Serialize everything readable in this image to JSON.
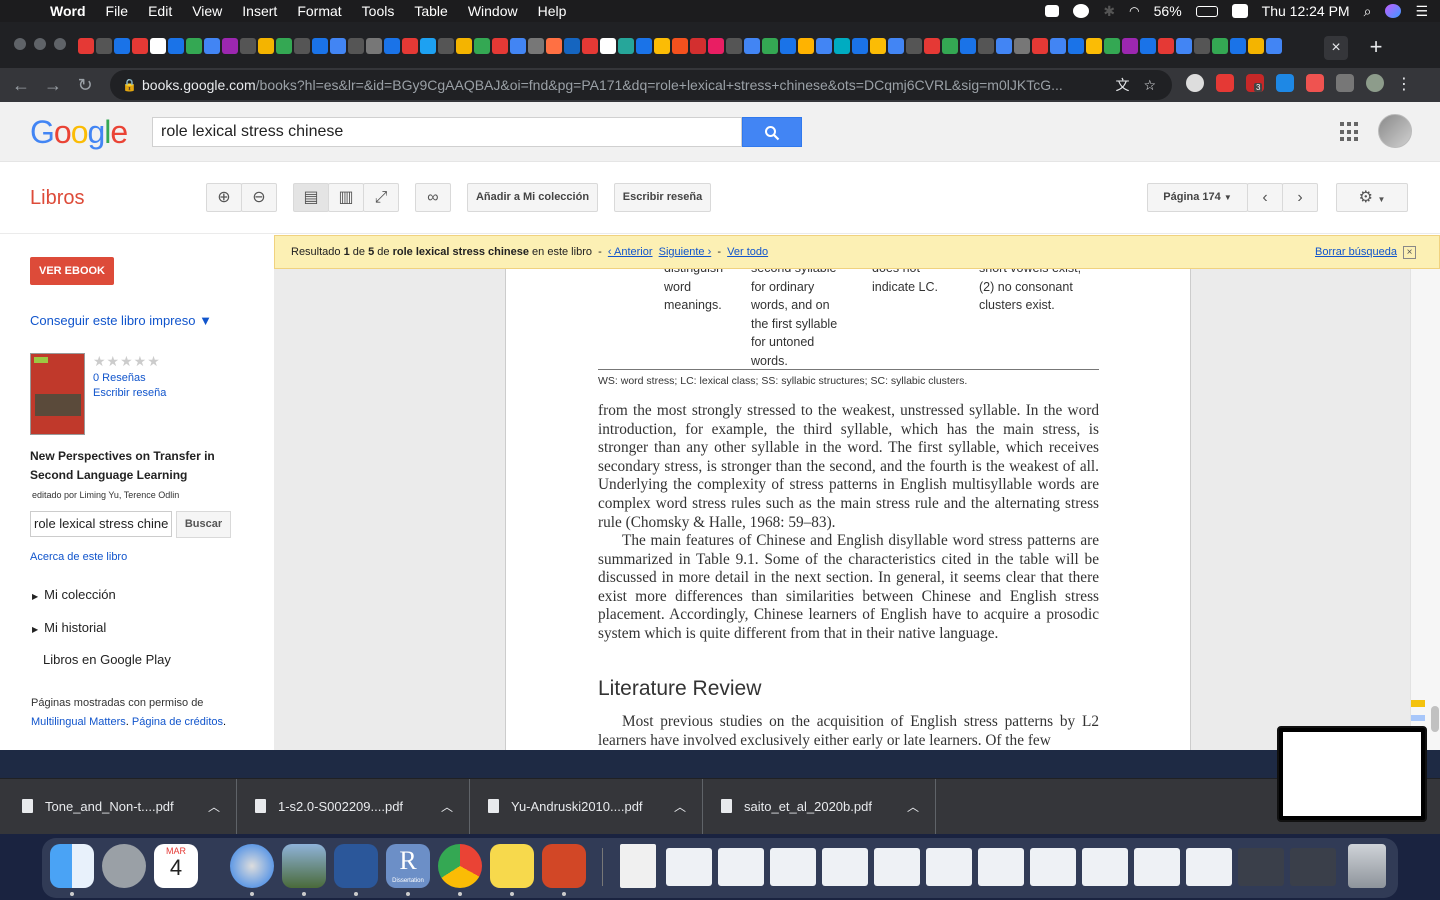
{
  "menubar": {
    "app": "Word",
    "items": [
      "File",
      "Edit",
      "View",
      "Insert",
      "Format",
      "Tools",
      "Table",
      "Window",
      "Help"
    ],
    "battery": "56%",
    "clock": "Thu 12:24 PM"
  },
  "browser": {
    "url_host": "books.google.com",
    "url_path": "/books?hl=es&lr=&id=BGy9CgAAQBAJ&oi=fnd&pg=PA171&dq=role+lexical+stress+chinese&ots=DCqmj6CVRL&sig=m0lJKTcG...",
    "new_tab": "+",
    "close_tab": "×",
    "abp_badge": "3"
  },
  "google": {
    "logo": "Google",
    "search_value": "role lexical stress chinese"
  },
  "books": {
    "section": "Libros",
    "add_collection": "Añadir a Mi colección",
    "write_review": "Escribir reseña",
    "page_select": "Página 174"
  },
  "left": {
    "ver_ebook": "VER EBOOK",
    "get_print": "Conseguir este libro impreso ▼",
    "reviews": "0 Reseñas",
    "write_review": "Escribir reseña",
    "title": "New Perspectives on Transfer in Second Language Learning",
    "editors": "editado por Liming Yu, Terence Odlin",
    "search_value": "role lexical stress chine",
    "search_btn": "Buscar",
    "about": "Acerca de este libro",
    "my_collection": "Mi colección",
    "my_history": "Mi historial",
    "play": "Libros en Google Play",
    "permission_1": "Páginas mostradas con permiso de",
    "permission_publisher": "Multilingual Matters",
    "permission_credits": "Página de créditos"
  },
  "result_bar": {
    "pre": "Resultado",
    "n": "1",
    "of": "de",
    "total": "5",
    "de": "de",
    "query": "role lexical stress chinese",
    "suffix": "en este libro",
    "prev": "‹ Anterior",
    "next": "Siguiente ›",
    "all": "Ver todo",
    "clear": "Borrar búsqueda"
  },
  "book_page": {
    "table_col1": [
      "distinguish",
      "word",
      "meanings."
    ],
    "table_col2": [
      "second syllable",
      "for ordinary",
      "words, and on",
      "the first syllable",
      "for untoned",
      "words."
    ],
    "table_col3": [
      "does not",
      "indicate LC."
    ],
    "table_col4": [
      "short vowels exist;",
      "(2) no consonant",
      "clusters exist."
    ],
    "table_note": "WS: word stress; LC: lexical class; SS: syllabic structures; SC: syllabic clusters.",
    "para1": "from the most strongly stressed to the weakest, unstressed syllable. In the word introduction, for example, the third syllable, which has the main stress, is stronger than any other syllable in the word. The first syllable, which receives secondary stress, is stronger than the second, and the fourth is the weakest of all. Underlying the complexity of stress patterns in English multisyllable words are complex word stress rules such as the main stress rule and the alternating stress rule (Chomsky & Halle, 1968: 59–83).",
    "para2": "The main features of Chinese and English disyllable word stress patterns are summarized in Table 9.1. Some of the characteristics cited in the table will be discussed in more detail in the next section. In general, it seems clear that there exist more differences than similarities between Chinese and English stress placement. Accordingly, Chinese learners of English have to acquire a prosodic system which is quite different from that in their native language.",
    "heading": "Literature Review",
    "para3": "Most previous studies on the acquisition of English stress patterns by L2 learners have involved exclusively either early or late learners. Of the few"
  },
  "downloads": [
    {
      "name": "Tone_and_Non-t....pdf"
    },
    {
      "name": "1-s2.0-S002209....pdf"
    },
    {
      "name": "Yu-Andruski2010....pdf"
    },
    {
      "name": "saito_et_al_2020b.pdf"
    }
  ],
  "dock": {
    "calendar_month": "MAR",
    "calendar_day": "4",
    "r_label": "R",
    "r_sublabel": "Dissertation"
  },
  "colors": {
    "google_blue": "#4285f4",
    "books_red": "#dd4b39",
    "result_yellow": "#fcf0b4"
  }
}
